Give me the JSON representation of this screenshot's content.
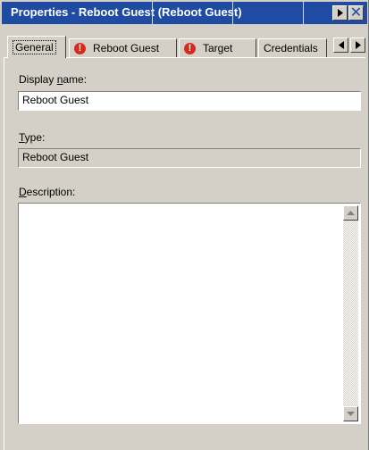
{
  "window": {
    "title": "Properties - Reboot Guest (Reboot Guest)"
  },
  "tabs": [
    {
      "label": "General",
      "icon": null,
      "active": true
    },
    {
      "label": "Reboot Guest",
      "icon": "error-icon",
      "active": false
    },
    {
      "label": "Target",
      "icon": "error-icon",
      "active": false
    },
    {
      "label": "Credentials",
      "icon": null,
      "active": false
    }
  ],
  "form": {
    "display_name": {
      "label_pre": "Display ",
      "label_mnemonic": "n",
      "label_post": "ame:",
      "value": "Reboot Guest"
    },
    "type": {
      "label_mnemonic": "T",
      "label_post": "ype:",
      "value": "Reboot Guest"
    },
    "description": {
      "label_mnemonic": "D",
      "label_post": "escription:",
      "value": ""
    }
  },
  "colors": {
    "titlebar": "#1f4ba3",
    "dialog_bg": "#d4d0c8",
    "error_icon": "#d52b1e"
  }
}
